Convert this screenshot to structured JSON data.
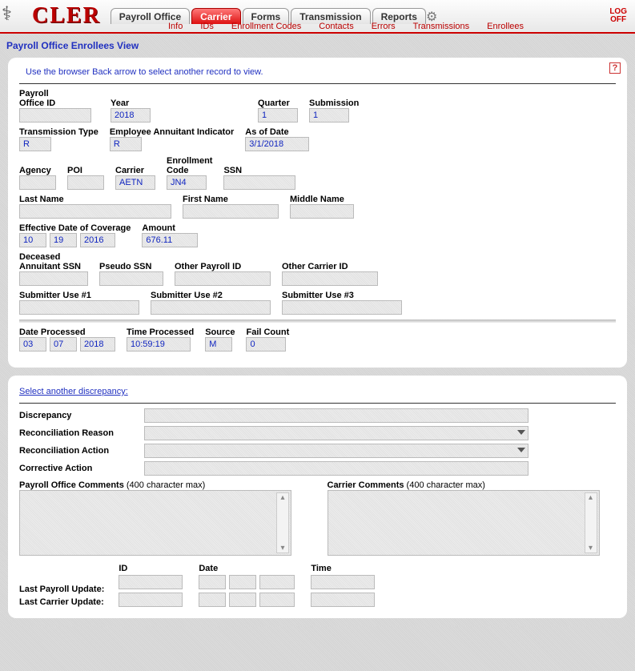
{
  "header": {
    "logo_text": "CLER",
    "tabs": [
      "Payroll Office",
      "Carrier",
      "Forms",
      "Transmission",
      "Reports"
    ],
    "active_tab_index": 1,
    "subtabs": [
      "Info",
      "IDs",
      "Enrollment Codes",
      "Contacts",
      "Errors",
      "Transmissions",
      "Enrollees"
    ],
    "logoff_line1": "LOG",
    "logoff_line2": "OFF"
  },
  "page_title": "Payroll Office Enrollees View",
  "hint": "Use the browser Back arrow to select another record to view.",
  "fields": {
    "payroll_office_id": {
      "label": "Payroll\nOffice ID",
      "value": ""
    },
    "year": {
      "label": "Year",
      "value": "2018"
    },
    "quarter": {
      "label": "Quarter",
      "value": "1"
    },
    "submission": {
      "label": "Submission",
      "value": "1"
    },
    "transmission_type": {
      "label": "Transmission Type",
      "value": "R"
    },
    "emp_ann_ind": {
      "label": "Employee Annuitant Indicator",
      "value": "R"
    },
    "as_of_date": {
      "label": "As of Date",
      "value": "3/1/2018"
    },
    "agency": {
      "label": "Agency",
      "value": ""
    },
    "poi": {
      "label": "POI",
      "value": ""
    },
    "carrier": {
      "label": "Carrier",
      "value": "AETN"
    },
    "enroll_code": {
      "label": "Enrollment\nCode",
      "value": "JN4"
    },
    "ssn": {
      "label": "SSN",
      "value": ""
    },
    "last_name": {
      "label": "Last Name",
      "value": ""
    },
    "first_name": {
      "label": "First Name",
      "value": ""
    },
    "middle_name": {
      "label": "Middle Name",
      "value": ""
    },
    "eff_date_label": "Effective Date of Coverage",
    "eff_mm": "10",
    "eff_dd": "19",
    "eff_yy": "2016",
    "amount": {
      "label": "Amount",
      "value": "676.11"
    },
    "deceased_ssn": {
      "label": "Deceased\nAnnuitant SSN",
      "value": ""
    },
    "pseudo_ssn": {
      "label": "Pseudo SSN",
      "value": ""
    },
    "other_payroll_id": {
      "label": "Other Payroll ID",
      "value": ""
    },
    "other_carrier_id": {
      "label": "Other Carrier ID",
      "value": ""
    },
    "sub1": {
      "label": "Submitter Use #1",
      "value": ""
    },
    "sub2": {
      "label": "Submitter Use #2",
      "value": ""
    },
    "sub3": {
      "label": "Submitter Use #3",
      "value": ""
    },
    "date_proc_label": "Date Processed",
    "dp_mm": "03",
    "dp_dd": "07",
    "dp_yy": "2018",
    "time_proc": {
      "label": "Time Processed",
      "value": "10:59:19"
    },
    "source": {
      "label": "Source",
      "value": "M"
    },
    "fail_count": {
      "label": "Fail Count",
      "value": "0"
    }
  },
  "disc": {
    "link": "Select another discrepancy:",
    "discrepancy": {
      "label": "Discrepancy",
      "value": ""
    },
    "recon_reason": {
      "label": "Reconciliation Reason",
      "value": ""
    },
    "recon_action": {
      "label": "Reconciliation Action",
      "value": ""
    },
    "corrective": {
      "label": "Corrective Action",
      "value": ""
    },
    "po_comments_label": "Payroll Office Comments",
    "carrier_comments_label": "Carrier Comments",
    "char_note": " (400 character max)",
    "update_headers": {
      "id": "ID",
      "date": "Date",
      "time": "Time"
    },
    "last_payroll_label": "Last Payroll Update:",
    "last_carrier_label": "Last Carrier Update:"
  }
}
